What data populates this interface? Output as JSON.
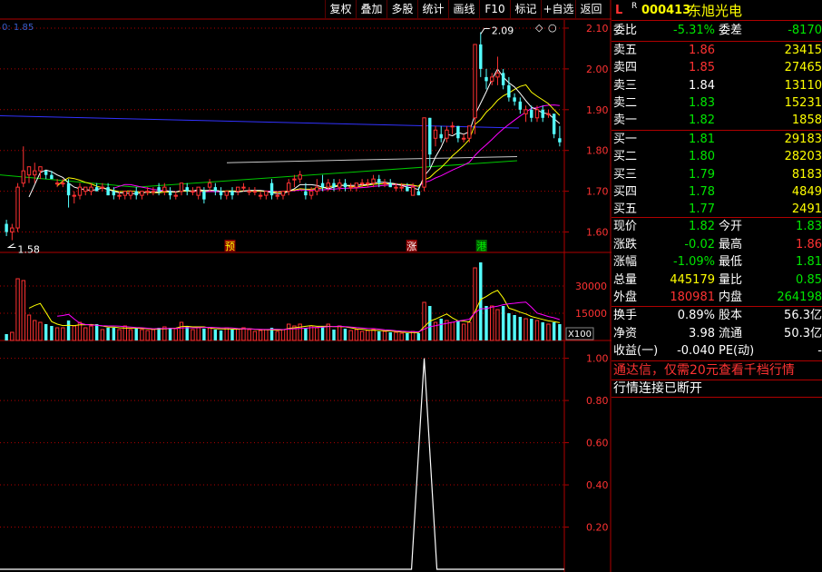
{
  "toolbar": {
    "items": [
      "复权",
      "叠加",
      "多股",
      "统计",
      "画线",
      "F10",
      "标记",
      "+自选",
      "返回"
    ]
  },
  "stock": {
    "flag": "L",
    "sup": "R",
    "code": "000413",
    "name": "东旭光电"
  },
  "stats_top": [
    {
      "l1": "委比",
      "v1": "-5.31%",
      "l2": "委差",
      "v2": "-8170"
    }
  ],
  "sells": [
    {
      "label": "卖五",
      "price": "1.86",
      "vol": "23415"
    },
    {
      "label": "卖四",
      "price": "1.85",
      "vol": "27465"
    },
    {
      "label": "卖三",
      "price": "1.84",
      "vol": "13110"
    },
    {
      "label": "卖二",
      "price": "1.83",
      "vol": "15231"
    },
    {
      "label": "卖一",
      "price": "1.82",
      "vol": "1858"
    }
  ],
  "buys": [
    {
      "label": "买一",
      "price": "1.81",
      "vol": "29183"
    },
    {
      "label": "买二",
      "price": "1.80",
      "vol": "28203"
    },
    {
      "label": "买三",
      "price": "1.79",
      "vol": "8183"
    },
    {
      "label": "买四",
      "price": "1.78",
      "vol": "4849"
    },
    {
      "label": "买五",
      "price": "1.77",
      "vol": "2491"
    }
  ],
  "quote": [
    {
      "l1": "现价",
      "v1": "1.82",
      "l2": "今开",
      "v2": "1.83"
    },
    {
      "l1": "涨跌",
      "v1": "-0.02",
      "l2": "最高",
      "v2": "1.86"
    },
    {
      "l1": "涨幅",
      "v1": "-1.09%",
      "l2": "最低",
      "v2": "1.81"
    },
    {
      "l1": "总量",
      "v1": "445179",
      "l2": "量比",
      "v2": "0.85"
    },
    {
      "l1": "外盘",
      "v1": "180981",
      "l2": "内盘",
      "v2": "264198"
    }
  ],
  "extra": [
    {
      "l1": "换手",
      "v1": "0.89%",
      "l2": "股本",
      "v2": "56.3亿"
    },
    {
      "l1": "净资",
      "v1": "3.98",
      "l2": "流通",
      "v2": "50.3亿"
    },
    {
      "l1": "收益(一)",
      "v1": "-0.040",
      "l2": "PE(动)",
      "v2": "-"
    }
  ],
  "notice": "通达信，仅需20元查看千档行情",
  "status": "行情连接已断开",
  "colors": {
    "up": "#ff3232",
    "down": "#54ffff",
    "grid": "#b00000",
    "ma5": "#ffffff",
    "ma10": "#ffff00",
    "ma20": "#ff00ff",
    "ma60": "#00c800",
    "ma120": "#3232ff"
  },
  "chart_data": {
    "type": "candlestick",
    "top_left_label": "0: 1.85",
    "high_marker": "2.09",
    "low_marker": "1.58",
    "price_ticks": [
      "2.10",
      "2.00",
      "1.90",
      "1.80",
      "1.70",
      "1.60"
    ],
    "price_range": [
      1.55,
      2.12
    ],
    "volume_ticks": [
      "30000",
      "15000"
    ],
    "volume_unit": "X100",
    "volume_max": 45000,
    "indicator_ticks": [
      "1.00",
      "0.80",
      "0.60",
      "0.40",
      "0.20"
    ],
    "indicator_range": [
      0,
      1.05
    ],
    "flags": [
      {
        "text": "预",
        "at": 16
      },
      {
        "text": "涨",
        "at": 29
      },
      {
        "text": "港",
        "at": 34
      }
    ],
    "candles": [
      {
        "o": 1.62,
        "h": 1.63,
        "l": 1.59,
        "c": 1.6,
        "v": 3500
      },
      {
        "o": 1.6,
        "h": 1.62,
        "l": 1.58,
        "c": 1.61,
        "v": 4500
      },
      {
        "o": 1.61,
        "h": 1.72,
        "l": 1.6,
        "c": 1.71,
        "v": 34000
      },
      {
        "o": 1.72,
        "h": 1.81,
        "l": 1.71,
        "c": 1.75,
        "v": 33000
      },
      {
        "o": 1.74,
        "h": 1.76,
        "l": 1.72,
        "c": 1.76,
        "v": 14000
      },
      {
        "o": 1.74,
        "h": 1.77,
        "l": 1.72,
        "c": 1.75,
        "v": 11000
      },
      {
        "o": 1.75,
        "h": 1.76,
        "l": 1.73,
        "c": 1.76,
        "v": 10000
      },
      {
        "o": 1.75,
        "h": 1.75,
        "l": 1.73,
        "c": 1.74,
        "v": 9000
      },
      {
        "o": 1.74,
        "h": 1.75,
        "l": 1.73,
        "c": 1.73,
        "v": 8000
      },
      {
        "o": 1.72,
        "h": 1.73,
        "l": 1.71,
        "c": 1.72,
        "v": 7000
      },
      {
        "o": 1.72,
        "h": 1.73,
        "l": 1.71,
        "c": 1.72,
        "v": 7000
      },
      {
        "o": 1.72,
        "h": 1.73,
        "l": 1.66,
        "c": 1.69,
        "v": 11000
      },
      {
        "o": 1.69,
        "h": 1.7,
        "l": 1.67,
        "c": 1.69,
        "v": 8000
      },
      {
        "o": 1.69,
        "h": 1.72,
        "l": 1.68,
        "c": 1.71,
        "v": 10000
      },
      {
        "o": 1.7,
        "h": 1.71,
        "l": 1.69,
        "c": 1.71,
        "v": 7000
      },
      {
        "o": 1.7,
        "h": 1.72,
        "l": 1.69,
        "c": 1.71,
        "v": 8000
      },
      {
        "o": 1.71,
        "h": 1.72,
        "l": 1.7,
        "c": 1.7,
        "v": 9000
      },
      {
        "o": 1.71,
        "h": 1.72,
        "l": 1.7,
        "c": 1.71,
        "v": 6000
      },
      {
        "o": 1.71,
        "h": 1.72,
        "l": 1.69,
        "c": 1.69,
        "v": 7000
      },
      {
        "o": 1.7,
        "h": 1.71,
        "l": 1.68,
        "c": 1.69,
        "v": 7000
      },
      {
        "o": 1.69,
        "h": 1.7,
        "l": 1.68,
        "c": 1.69,
        "v": 6000
      },
      {
        "o": 1.69,
        "h": 1.7,
        "l": 1.68,
        "c": 1.7,
        "v": 8000
      },
      {
        "o": 1.69,
        "h": 1.7,
        "l": 1.68,
        "c": 1.7,
        "v": 6000
      },
      {
        "o": 1.7,
        "h": 1.71,
        "l": 1.68,
        "c": 1.69,
        "v": 7000
      },
      {
        "o": 1.69,
        "h": 1.7,
        "l": 1.68,
        "c": 1.7,
        "v": 6000
      },
      {
        "o": 1.7,
        "h": 1.71,
        "l": 1.69,
        "c": 1.7,
        "v": 5500
      },
      {
        "o": 1.7,
        "h": 1.71,
        "l": 1.69,
        "c": 1.7,
        "v": 6000
      },
      {
        "o": 1.71,
        "h": 1.72,
        "l": 1.69,
        "c": 1.7,
        "v": 7000
      },
      {
        "o": 1.7,
        "h": 1.72,
        "l": 1.69,
        "c": 1.71,
        "v": 7500
      },
      {
        "o": 1.7,
        "h": 1.71,
        "l": 1.68,
        "c": 1.69,
        "v": 7000
      },
      {
        "o": 1.69,
        "h": 1.7,
        "l": 1.68,
        "c": 1.69,
        "v": 6500
      },
      {
        "o": 1.7,
        "h": 1.72,
        "l": 1.69,
        "c": 1.72,
        "v": 10000
      },
      {
        "o": 1.71,
        "h": 1.72,
        "l": 1.69,
        "c": 1.7,
        "v": 8000
      },
      {
        "o": 1.7,
        "h": 1.71,
        "l": 1.69,
        "c": 1.7,
        "v": 6000
      },
      {
        "o": 1.69,
        "h": 1.71,
        "l": 1.68,
        "c": 1.71,
        "v": 7000
      },
      {
        "o": 1.7,
        "h": 1.71,
        "l": 1.67,
        "c": 1.68,
        "v": 6500
      },
      {
        "o": 1.71,
        "h": 1.73,
        "l": 1.7,
        "c": 1.72,
        "v": 7000
      },
      {
        "o": 1.71,
        "h": 1.72,
        "l": 1.69,
        "c": 1.7,
        "v": 6000
      },
      {
        "o": 1.7,
        "h": 1.71,
        "l": 1.68,
        "c": 1.69,
        "v": 5500
      },
      {
        "o": 1.69,
        "h": 1.7,
        "l": 1.68,
        "c": 1.7,
        "v": 7000
      },
      {
        "o": 1.7,
        "h": 1.71,
        "l": 1.68,
        "c": 1.69,
        "v": 6000
      },
      {
        "o": 1.7,
        "h": 1.71,
        "l": 1.69,
        "c": 1.71,
        "v": 6500
      },
      {
        "o": 1.71,
        "h": 1.72,
        "l": 1.7,
        "c": 1.71,
        "v": 7000
      },
      {
        "o": 1.7,
        "h": 1.71,
        "l": 1.69,
        "c": 1.7,
        "v": 6000
      },
      {
        "o": 1.7,
        "h": 1.71,
        "l": 1.69,
        "c": 1.7,
        "v": 5000
      },
      {
        "o": 1.69,
        "h": 1.7,
        "l": 1.68,
        "c": 1.69,
        "v": 5500
      },
      {
        "o": 1.69,
        "h": 1.7,
        "l": 1.68,
        "c": 1.7,
        "v": 6000
      },
      {
        "o": 1.72,
        "h": 1.73,
        "l": 1.68,
        "c": 1.69,
        "v": 7000
      },
      {
        "o": 1.69,
        "h": 1.7,
        "l": 1.68,
        "c": 1.69,
        "v": 5000
      },
      {
        "o": 1.69,
        "h": 1.7,
        "l": 1.68,
        "c": 1.7,
        "v": 6000
      },
      {
        "o": 1.7,
        "h": 1.73,
        "l": 1.69,
        "c": 1.72,
        "v": 9000
      },
      {
        "o": 1.73,
        "h": 1.74,
        "l": 1.71,
        "c": 1.73,
        "v": 8000
      },
      {
        "o": 1.73,
        "h": 1.75,
        "l": 1.72,
        "c": 1.74,
        "v": 9000
      },
      {
        "o": 1.7,
        "h": 1.72,
        "l": 1.68,
        "c": 1.69,
        "v": 7000
      },
      {
        "o": 1.69,
        "h": 1.71,
        "l": 1.68,
        "c": 1.7,
        "v": 8000
      },
      {
        "o": 1.7,
        "h": 1.73,
        "l": 1.69,
        "c": 1.71,
        "v": 7000
      },
      {
        "o": 1.72,
        "h": 1.74,
        "l": 1.7,
        "c": 1.71,
        "v": 8000
      },
      {
        "o": 1.71,
        "h": 1.73,
        "l": 1.7,
        "c": 1.72,
        "v": 9000
      },
      {
        "o": 1.72,
        "h": 1.73,
        "l": 1.7,
        "c": 1.71,
        "v": 6000
      },
      {
        "o": 1.71,
        "h": 1.73,
        "l": 1.7,
        "c": 1.72,
        "v": 8000
      },
      {
        "o": 1.72,
        "h": 1.73,
        "l": 1.7,
        "c": 1.71,
        "v": 6500
      },
      {
        "o": 1.71,
        "h": 1.72,
        "l": 1.7,
        "c": 1.71,
        "v": 5500
      },
      {
        "o": 1.71,
        "h": 1.72,
        "l": 1.7,
        "c": 1.72,
        "v": 6000
      },
      {
        "o": 1.72,
        "h": 1.73,
        "l": 1.71,
        "c": 1.72,
        "v": 5000
      },
      {
        "o": 1.72,
        "h": 1.73,
        "l": 1.71,
        "c": 1.72,
        "v": 5500
      },
      {
        "o": 1.72,
        "h": 1.74,
        "l": 1.71,
        "c": 1.73,
        "v": 6000
      },
      {
        "o": 1.73,
        "h": 1.74,
        "l": 1.71,
        "c": 1.72,
        "v": 5000
      },
      {
        "o": 1.72,
        "h": 1.73,
        "l": 1.71,
        "c": 1.72,
        "v": 5000
      },
      {
        "o": 1.72,
        "h": 1.73,
        "l": 1.71,
        "c": 1.71,
        "v": 4500
      },
      {
        "o": 1.71,
        "h": 1.72,
        "l": 1.7,
        "c": 1.71,
        "v": 4500
      },
      {
        "o": 1.71,
        "h": 1.72,
        "l": 1.7,
        "c": 1.71,
        "v": 4000
      },
      {
        "o": 1.71,
        "h": 1.72,
        "l": 1.7,
        "c": 1.7,
        "v": 4000
      },
      {
        "o": 1.69,
        "h": 1.72,
        "l": 1.69,
        "c": 1.71,
        "v": 5000
      },
      {
        "o": 1.7,
        "h": 1.71,
        "l": 1.69,
        "c": 1.69,
        "v": 4000
      },
      {
        "o": 1.71,
        "h": 1.88,
        "l": 1.7,
        "c": 1.88,
        "v": 21000
      },
      {
        "o": 1.88,
        "h": 1.88,
        "l": 1.76,
        "c": 1.79,
        "v": 19000
      },
      {
        "o": 1.83,
        "h": 1.86,
        "l": 1.81,
        "c": 1.85,
        "v": 10000
      },
      {
        "o": 1.84,
        "h": 1.86,
        "l": 1.82,
        "c": 1.83,
        "v": 12000
      },
      {
        "o": 1.83,
        "h": 1.86,
        "l": 1.82,
        "c": 1.85,
        "v": 11000
      },
      {
        "o": 1.86,
        "h": 1.87,
        "l": 1.84,
        "c": 1.86,
        "v": 10000
      },
      {
        "o": 1.86,
        "h": 1.86,
        "l": 1.82,
        "c": 1.83,
        "v": 11000
      },
      {
        "o": 1.83,
        "h": 1.84,
        "l": 1.82,
        "c": 1.83,
        "v": 9000
      },
      {
        "o": 1.83,
        "h": 1.86,
        "l": 1.82,
        "c": 1.86,
        "v": 10000
      },
      {
        "o": 1.88,
        "h": 2.06,
        "l": 1.84,
        "c": 2.06,
        "v": 40000
      },
      {
        "o": 2.06,
        "h": 2.09,
        "l": 1.98,
        "c": 2.0,
        "v": 43000
      },
      {
        "o": 1.98,
        "h": 2.0,
        "l": 1.95,
        "c": 1.97,
        "v": 19000
      },
      {
        "o": 1.97,
        "h": 1.99,
        "l": 1.96,
        "c": 1.98,
        "v": 19000
      },
      {
        "o": 1.98,
        "h": 2.03,
        "l": 1.96,
        "c": 1.99,
        "v": 17000
      },
      {
        "o": 1.99,
        "h": 2.0,
        "l": 1.95,
        "c": 1.96,
        "v": 19000
      },
      {
        "o": 1.96,
        "h": 1.98,
        "l": 1.92,
        "c": 1.93,
        "v": 15000
      },
      {
        "o": 1.93,
        "h": 1.94,
        "l": 1.91,
        "c": 1.92,
        "v": 14000
      },
      {
        "o": 1.92,
        "h": 1.93,
        "l": 1.89,
        "c": 1.9,
        "v": 13000
      },
      {
        "o": 1.89,
        "h": 1.91,
        "l": 1.87,
        "c": 1.9,
        "v": 12000
      },
      {
        "o": 1.9,
        "h": 1.91,
        "l": 1.87,
        "c": 1.88,
        "v": 12000
      },
      {
        "o": 1.88,
        "h": 1.91,
        "l": 1.87,
        "c": 1.9,
        "v": 11000
      },
      {
        "o": 1.9,
        "h": 1.91,
        "l": 1.87,
        "c": 1.88,
        "v": 10000
      },
      {
        "o": 1.89,
        "h": 1.9,
        "l": 1.88,
        "c": 1.89,
        "v": 9000
      },
      {
        "o": 1.89,
        "h": 1.89,
        "l": 1.83,
        "c": 1.84,
        "v": 10000
      },
      {
        "o": 1.83,
        "h": 1.86,
        "l": 1.81,
        "c": 1.82,
        "v": 9000
      }
    ],
    "indicator_spike": {
      "index": 74,
      "value": 1.0
    }
  }
}
